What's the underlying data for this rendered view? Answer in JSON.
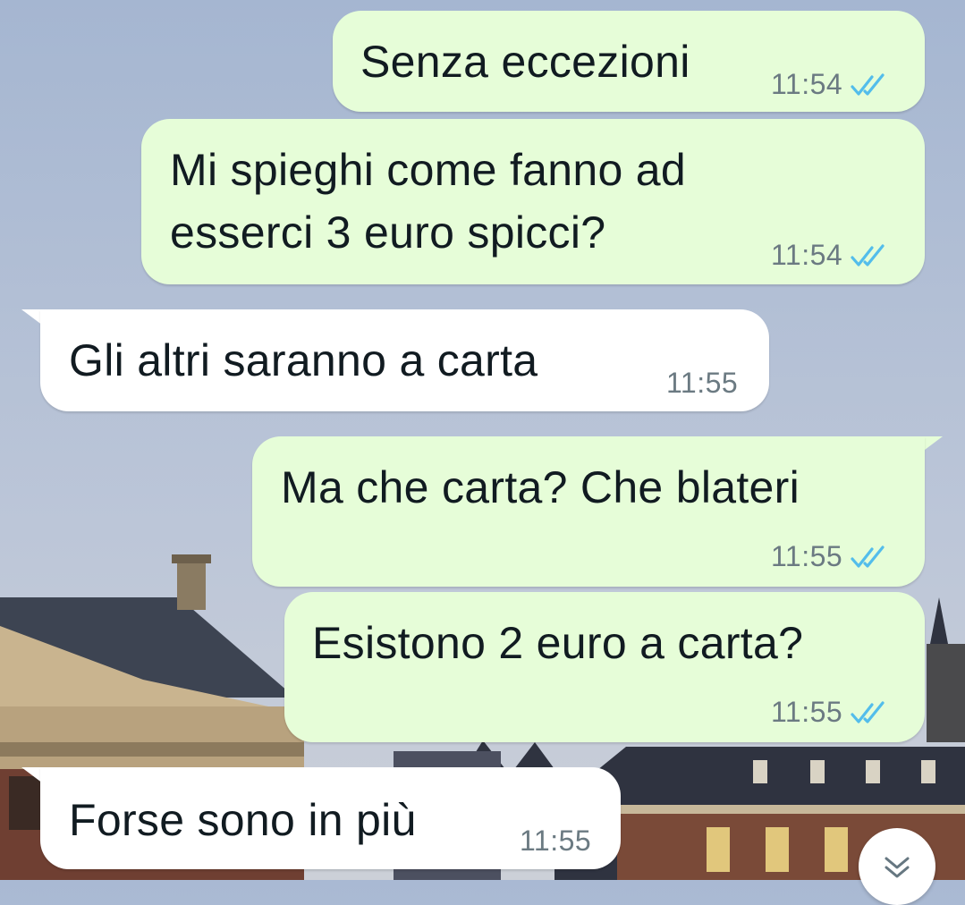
{
  "messages": [
    {
      "id": "m1",
      "direction": "outgoing",
      "lines": [
        "Senza eccezioni"
      ],
      "time": "11:54",
      "status": "read"
    },
    {
      "id": "m2",
      "direction": "outgoing",
      "lines": [
        "Mi spieghi come fanno ad",
        "esserci 3 euro spicci?"
      ],
      "time": "11:54",
      "status": "read"
    },
    {
      "id": "m3",
      "direction": "incoming",
      "lines": [
        "Gli altri saranno a carta"
      ],
      "time": "11:55"
    },
    {
      "id": "m4",
      "direction": "outgoing",
      "lines": [
        "Ma che carta? Che blateri"
      ],
      "time": "11:55",
      "status": "read"
    },
    {
      "id": "m5",
      "direction": "outgoing",
      "lines": [
        "Esistono 2 euro a carta?"
      ],
      "time": "11:55",
      "status": "read"
    },
    {
      "id": "m6",
      "direction": "incoming",
      "lines": [
        "Forse sono in più"
      ],
      "time": "11:55"
    }
  ],
  "icons": {
    "read_ticks": "double-check-icon",
    "scroll_down": "chevron-double-down-icon"
  },
  "colors": {
    "outgoing_bubble": "#e6fdd8",
    "incoming_bubble": "#ffffff",
    "read_tick": "#53bdeb",
    "timestamp": "#6b7a82"
  }
}
